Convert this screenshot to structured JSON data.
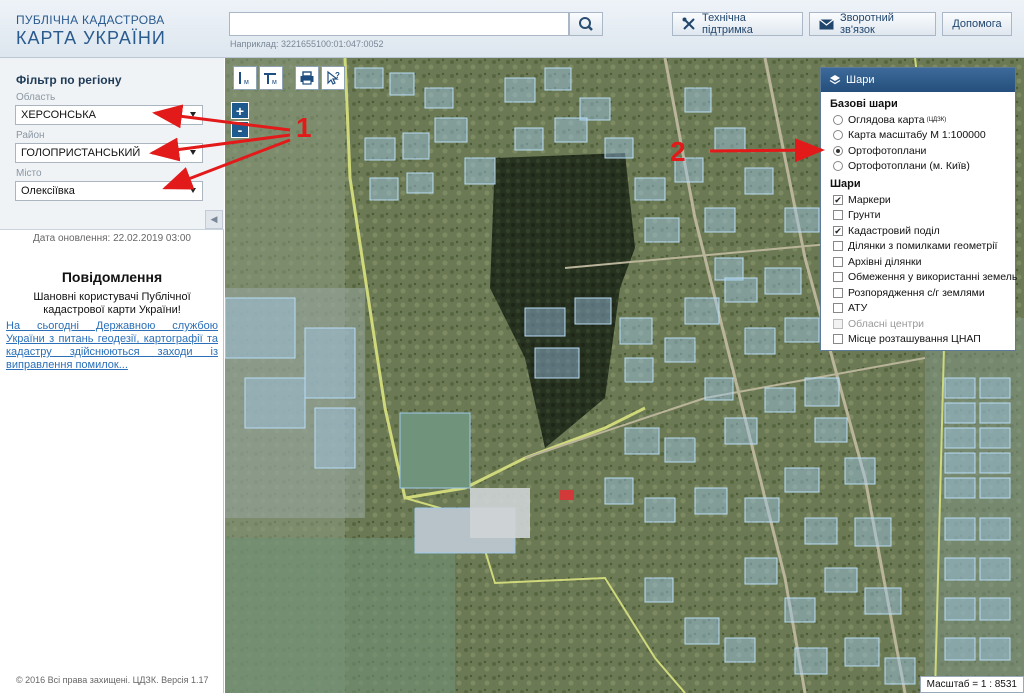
{
  "header": {
    "logo_top": "ПУБЛІЧНА КАДАСТРОВА",
    "logo_bottom": "КАРТА УКРАЇНИ",
    "search_value": "",
    "search_hint": "Наприклад: 3221655100:01:047:0052",
    "buttons": {
      "support": "Технічна підтримка",
      "feedback": "Зворотний зв'язок",
      "help": "Допомога"
    }
  },
  "filter": {
    "title": "Фільтр по регіону",
    "oblast_label": "Область",
    "oblast_value": "ХЕРСОНСЬКА",
    "rayon_label": "Район",
    "rayon_value": "ГОЛОПРИСТАНСЬКИЙ",
    "misto_label": "Місто",
    "misto_value": "Олексіївка"
  },
  "update_date": "Дата оновлення: 22.02.2019 03:00",
  "notice": {
    "title": "Повідомлення",
    "text": "Шановні користувачі Публічної кадастрової карти України!",
    "link": "На сьогодні Державною службою України з питань геодезії, картографії та кадастру здійснюються заходи із виправлення помилок..."
  },
  "copyright": "© 2016 Всі права захищені. ЦДЗК. Версія 1.17",
  "map": {
    "zoom_in": "+",
    "zoom_out": "-",
    "tool_m": "м",
    "scale": "Масштаб = 1 : 8531"
  },
  "layers": {
    "title": "Шари",
    "base_section": "Базові шари",
    "base": [
      {
        "label": "Оглядова карта",
        "sup": "(ЦДЗК)",
        "selected": false
      },
      {
        "label": "Карта масштабу М 1:100000",
        "selected": false
      },
      {
        "label": "Ортофотоплани",
        "selected": true
      },
      {
        "label": "Ортофотоплани (м. Київ)",
        "selected": false
      }
    ],
    "overlay_section": "Шари",
    "overlays": [
      {
        "label": "Маркери",
        "checked": true,
        "disabled": false
      },
      {
        "label": "Грунти",
        "checked": false,
        "disabled": false
      },
      {
        "label": "Кадастровий поділ",
        "checked": true,
        "disabled": false
      },
      {
        "label": "Ділянки з помилками геометрії",
        "checked": false,
        "disabled": false
      },
      {
        "label": "Архівні ділянки",
        "checked": false,
        "disabled": false
      },
      {
        "label": "Обмеження у використанні земель",
        "checked": false,
        "disabled": false
      },
      {
        "label": "Розпорядження с/г землями",
        "checked": false,
        "disabled": false
      },
      {
        "label": "АТУ",
        "checked": false,
        "disabled": false
      },
      {
        "label": "Обласні центри",
        "checked": false,
        "disabled": true
      },
      {
        "label": "Місце розташування ЦНАП",
        "checked": false,
        "disabled": false
      }
    ]
  },
  "annotations": {
    "label1": "1",
    "label2": "2"
  },
  "colors": {
    "accent": "#254f7c",
    "annotation": "#e21a1a",
    "parcel": "#9fc8ea"
  }
}
